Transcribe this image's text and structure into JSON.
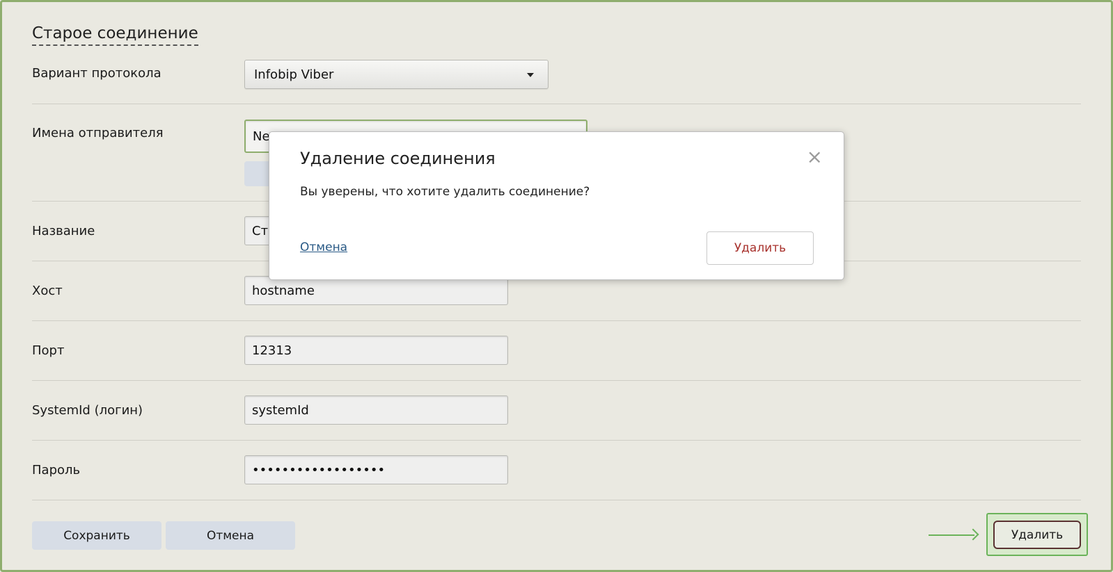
{
  "form": {
    "title": "Старое соединение",
    "protocol": {
      "label": "Вариант протокола",
      "value": "Infobip Viber"
    },
    "sender": {
      "label": "Имена отправителя",
      "value": "Ne"
    },
    "name": {
      "label": "Название",
      "value": "Ста"
    },
    "host": {
      "label": "Хост",
      "value": "hostname"
    },
    "port": {
      "label": "Порт",
      "value": "12313"
    },
    "systemid": {
      "label": "SystemId (логин)",
      "value": "systemId"
    },
    "password": {
      "label": "Пароль",
      "value": "••••••••••••••••••"
    },
    "save_label": "Сохранить",
    "cancel_label": "Отмена",
    "delete_label": "Удалить"
  },
  "modal": {
    "title": "Удаление соединения",
    "close_symbol": "×",
    "message": "Вы уверены, что хотите удалить соединение?",
    "cancel_label": "Отмена",
    "delete_label": "Удалить"
  },
  "colors": {
    "highlight": "#6bb35a",
    "frame": "#8fae6e",
    "danger": "#a8322d",
    "link": "#2a5a86"
  }
}
